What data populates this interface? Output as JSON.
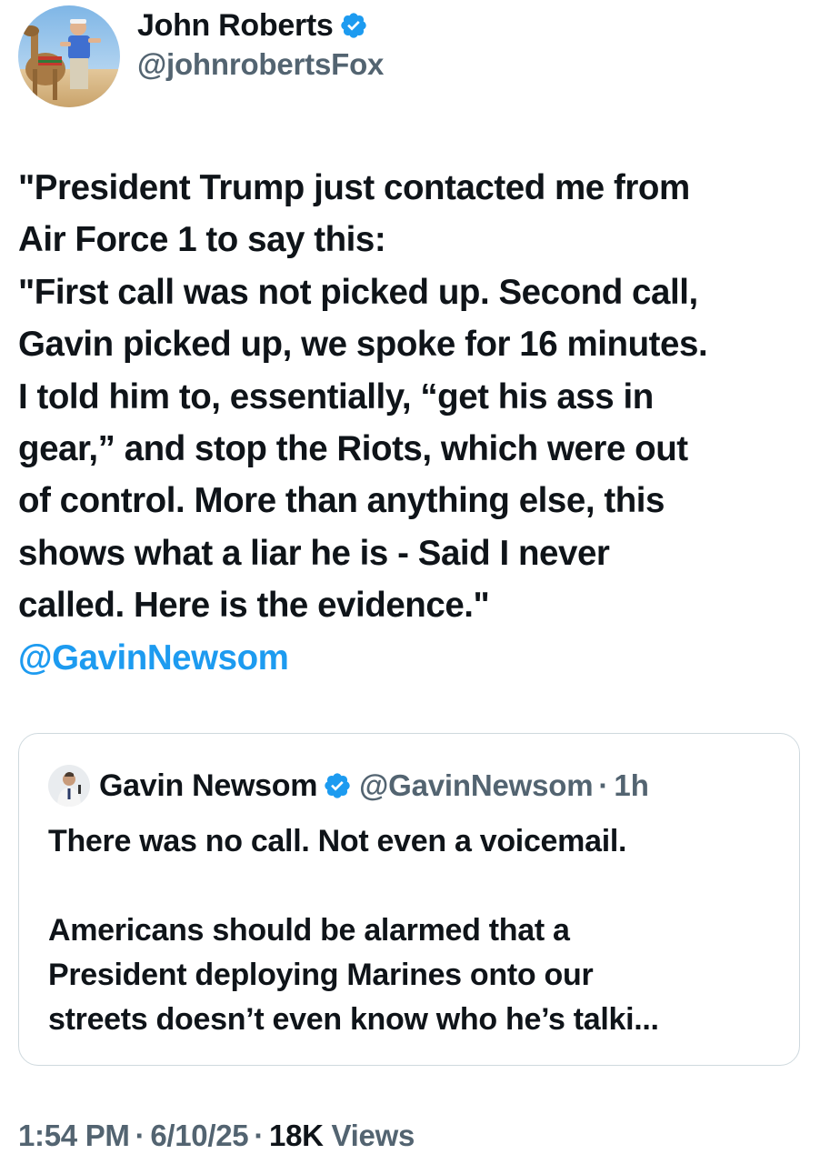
{
  "author": {
    "name": "John Roberts",
    "handle": "@johnrobertsFox",
    "verified": true,
    "avatar": "profile-photo"
  },
  "tweet": {
    "lines": [
      "\"President Trump just contacted me from",
      "Air Force 1 to say this:",
      "\"First call was not picked up. Second call,",
      "Gavin picked up, we spoke for 16 minutes.",
      "I told him to, essentially, “get his ass in",
      "gear,” and stop the Riots, which were out",
      "of control. More than anything else, this",
      "shows what a liar he is - Said I never",
      "called. Here is the evidence.\""
    ],
    "mention": "@GavinNewsom"
  },
  "quoted_tweet": {
    "name": "Gavin Newsom",
    "handle": "@GavinNewsom",
    "separator": "·",
    "time": "1h",
    "verified": true,
    "lines": [
      "There was no call. Not even a voicemail.",
      "",
      "Americans should be alarmed that a",
      "President deploying Marines onto our",
      "streets doesn’t even know who he’s talki..."
    ]
  },
  "meta": {
    "time": "1:54 PM",
    "separator": "·",
    "date": "6/10/25",
    "views_count": "18K",
    "views_label": " Views"
  },
  "colors": {
    "link": "#1d9bf0",
    "verified": "#1d9bf0",
    "secondary_text": "#536471",
    "primary_text": "#0f1419",
    "border": "#cfd9de"
  }
}
